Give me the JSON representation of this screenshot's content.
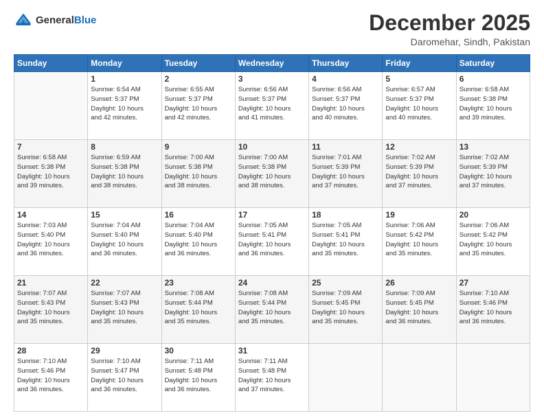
{
  "header": {
    "logo_general": "General",
    "logo_blue": "Blue",
    "month_year": "December 2025",
    "location": "Daromehar, Sindh, Pakistan"
  },
  "days_of_week": [
    "Sunday",
    "Monday",
    "Tuesday",
    "Wednesday",
    "Thursday",
    "Friday",
    "Saturday"
  ],
  "weeks": [
    [
      {
        "day": "",
        "info": ""
      },
      {
        "day": "1",
        "info": "Sunrise: 6:54 AM\nSunset: 5:37 PM\nDaylight: 10 hours\nand 42 minutes."
      },
      {
        "day": "2",
        "info": "Sunrise: 6:55 AM\nSunset: 5:37 PM\nDaylight: 10 hours\nand 42 minutes."
      },
      {
        "day": "3",
        "info": "Sunrise: 6:56 AM\nSunset: 5:37 PM\nDaylight: 10 hours\nand 41 minutes."
      },
      {
        "day": "4",
        "info": "Sunrise: 6:56 AM\nSunset: 5:37 PM\nDaylight: 10 hours\nand 40 minutes."
      },
      {
        "day": "5",
        "info": "Sunrise: 6:57 AM\nSunset: 5:37 PM\nDaylight: 10 hours\nand 40 minutes."
      },
      {
        "day": "6",
        "info": "Sunrise: 6:58 AM\nSunset: 5:38 PM\nDaylight: 10 hours\nand 39 minutes."
      }
    ],
    [
      {
        "day": "7",
        "info": "Sunrise: 6:58 AM\nSunset: 5:38 PM\nDaylight: 10 hours\nand 39 minutes."
      },
      {
        "day": "8",
        "info": "Sunrise: 6:59 AM\nSunset: 5:38 PM\nDaylight: 10 hours\nand 38 minutes."
      },
      {
        "day": "9",
        "info": "Sunrise: 7:00 AM\nSunset: 5:38 PM\nDaylight: 10 hours\nand 38 minutes."
      },
      {
        "day": "10",
        "info": "Sunrise: 7:00 AM\nSunset: 5:38 PM\nDaylight: 10 hours\nand 38 minutes."
      },
      {
        "day": "11",
        "info": "Sunrise: 7:01 AM\nSunset: 5:39 PM\nDaylight: 10 hours\nand 37 minutes."
      },
      {
        "day": "12",
        "info": "Sunrise: 7:02 AM\nSunset: 5:39 PM\nDaylight: 10 hours\nand 37 minutes."
      },
      {
        "day": "13",
        "info": "Sunrise: 7:02 AM\nSunset: 5:39 PM\nDaylight: 10 hours\nand 37 minutes."
      }
    ],
    [
      {
        "day": "14",
        "info": "Sunrise: 7:03 AM\nSunset: 5:40 PM\nDaylight: 10 hours\nand 36 minutes."
      },
      {
        "day": "15",
        "info": "Sunrise: 7:04 AM\nSunset: 5:40 PM\nDaylight: 10 hours\nand 36 minutes."
      },
      {
        "day": "16",
        "info": "Sunrise: 7:04 AM\nSunset: 5:40 PM\nDaylight: 10 hours\nand 36 minutes."
      },
      {
        "day": "17",
        "info": "Sunrise: 7:05 AM\nSunset: 5:41 PM\nDaylight: 10 hours\nand 36 minutes."
      },
      {
        "day": "18",
        "info": "Sunrise: 7:05 AM\nSunset: 5:41 PM\nDaylight: 10 hours\nand 35 minutes."
      },
      {
        "day": "19",
        "info": "Sunrise: 7:06 AM\nSunset: 5:42 PM\nDaylight: 10 hours\nand 35 minutes."
      },
      {
        "day": "20",
        "info": "Sunrise: 7:06 AM\nSunset: 5:42 PM\nDaylight: 10 hours\nand 35 minutes."
      }
    ],
    [
      {
        "day": "21",
        "info": "Sunrise: 7:07 AM\nSunset: 5:43 PM\nDaylight: 10 hours\nand 35 minutes."
      },
      {
        "day": "22",
        "info": "Sunrise: 7:07 AM\nSunset: 5:43 PM\nDaylight: 10 hours\nand 35 minutes."
      },
      {
        "day": "23",
        "info": "Sunrise: 7:08 AM\nSunset: 5:44 PM\nDaylight: 10 hours\nand 35 minutes."
      },
      {
        "day": "24",
        "info": "Sunrise: 7:08 AM\nSunset: 5:44 PM\nDaylight: 10 hours\nand 35 minutes."
      },
      {
        "day": "25",
        "info": "Sunrise: 7:09 AM\nSunset: 5:45 PM\nDaylight: 10 hours\nand 35 minutes."
      },
      {
        "day": "26",
        "info": "Sunrise: 7:09 AM\nSunset: 5:45 PM\nDaylight: 10 hours\nand 36 minutes."
      },
      {
        "day": "27",
        "info": "Sunrise: 7:10 AM\nSunset: 5:46 PM\nDaylight: 10 hours\nand 36 minutes."
      }
    ],
    [
      {
        "day": "28",
        "info": "Sunrise: 7:10 AM\nSunset: 5:46 PM\nDaylight: 10 hours\nand 36 minutes."
      },
      {
        "day": "29",
        "info": "Sunrise: 7:10 AM\nSunset: 5:47 PM\nDaylight: 10 hours\nand 36 minutes."
      },
      {
        "day": "30",
        "info": "Sunrise: 7:11 AM\nSunset: 5:48 PM\nDaylight: 10 hours\nand 36 minutes."
      },
      {
        "day": "31",
        "info": "Sunrise: 7:11 AM\nSunset: 5:48 PM\nDaylight: 10 hours\nand 37 minutes."
      },
      {
        "day": "",
        "info": ""
      },
      {
        "day": "",
        "info": ""
      },
      {
        "day": "",
        "info": ""
      }
    ]
  ]
}
